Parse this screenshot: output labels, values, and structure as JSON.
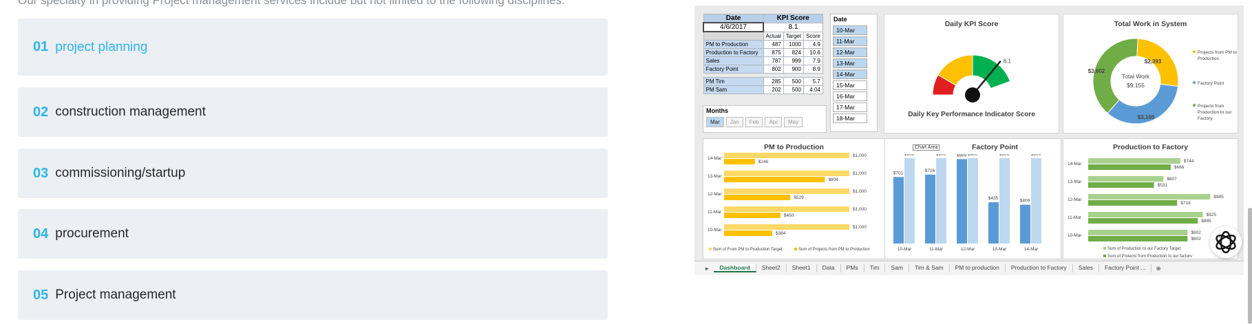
{
  "intro_text": "Our specialty in providing Project management services include but not limited to the following disciplines:",
  "accordion": [
    {
      "num": "01",
      "label": "project planning",
      "active": true
    },
    {
      "num": "02",
      "label": "construction management"
    },
    {
      "num": "03",
      "label": "commissioning/startup"
    },
    {
      "num": "04",
      "label": "procurement"
    },
    {
      "num": "05",
      "label": "Project management"
    }
  ],
  "dashboard": {
    "kpi_table": {
      "date_header": "Date",
      "kpi_header": "KPI Score",
      "date_value": "4/6/2017",
      "kpi_value": "8.1",
      "cols": [
        "Actual",
        "Target",
        "Score"
      ],
      "rows": [
        {
          "name": "PM to Production",
          "actual": "487",
          "target": "1000",
          "score": "4.9"
        },
        {
          "name": "Production to Factory",
          "actual": "875",
          "target": "824",
          "score": "10.6"
        },
        {
          "name": "Sales",
          "actual": "787",
          "target": "999",
          "score": "7.9"
        },
        {
          "name": "Factory Point",
          "actual": "802",
          "target": "900",
          "score": "8.9"
        }
      ],
      "pm_rows": [
        {
          "name": "PM Tim",
          "actual": "285",
          "target": "500",
          "score": "5.7"
        },
        {
          "name": "PM Sam",
          "actual": "202",
          "target": "500",
          "score": "4.04"
        }
      ]
    },
    "date_slicer": {
      "title": "Date",
      "items": [
        "10-Mar",
        "11-Mar",
        "12-Mar",
        "13-Mar",
        "14-Mar",
        "15-Mar",
        "16-Mar",
        "17-Mar",
        "18-Mar"
      ],
      "selected_count": 5
    },
    "months_slicer": {
      "title": "Months",
      "items": [
        "Mar",
        "Jan",
        "Feb",
        "Apr",
        "May"
      ]
    },
    "sheet_tabs": [
      "Dashboard",
      "Sheet2",
      "Sheet1",
      "Data",
      "PMs",
      "Tim",
      "Sam",
      "Tim & Sam",
      "PM to production",
      "Production to Factory",
      "Sales",
      "Factory Point ..."
    ],
    "tooltip": "Chart Area"
  },
  "chart_data": [
    {
      "type": "gauge",
      "title": "Daily KPI Score",
      "subtitle": "Daily Key Performance Indicator Score",
      "value": 8.1,
      "value_label": "8.1",
      "bands": [
        {
          "color": "#e02020"
        },
        {
          "color": "#ffc000"
        },
        {
          "color": "#00b050"
        }
      ]
    },
    {
      "type": "pie",
      "title": "Total Work in System",
      "center_label": "Total Work",
      "center_value": "$9,155",
      "slices": [
        {
          "label": "$2,393",
          "value": 2393,
          "color": "#ffc000"
        },
        {
          "label": "$3,160",
          "value": 3160,
          "color": "#5b9bd5"
        },
        {
          "label": "$3,602",
          "value": 3602,
          "color": "#70ad47"
        }
      ],
      "legend": [
        "Projects from PM to Production",
        "Factory Point",
        "Projects from Production to our Factory"
      ]
    },
    {
      "type": "bar",
      "title": "PM to Production",
      "categories": [
        "14-Mar",
        "13-Mar",
        "12-Mar",
        "11-Mar",
        "10-Mar"
      ],
      "series": [
        {
          "name": "Sum of From PM to Production Target",
          "values": [
            1000,
            1000,
            1000,
            1000,
            1000
          ],
          "labels": [
            "$1,000",
            "$1,000",
            "$1,000",
            "$1,000",
            "$1,000"
          ],
          "color": "#ffd966"
        },
        {
          "name": "Sum of Projects from PM to Production",
          "values": [
            246,
            804,
            529,
            450,
            384
          ],
          "labels": [
            "$246",
            "$804",
            "$529",
            "$450",
            "$384"
          ],
          "color": "#ffc000"
        }
      ]
    },
    {
      "type": "bar",
      "title": "Factory Point",
      "categories": [
        "10-Mar",
        "11-Mar",
        "12-Mar",
        "13-Mar",
        "14-Mar"
      ],
      "series": [
        {
          "values": [
            701,
            726,
            889,
            435,
            409
          ],
          "labels": [
            "$701",
            "$726",
            "$889",
            "$435",
            "$409"
          ],
          "color": "#5b9bd5"
        },
        {
          "values": [
            900,
            900,
            900,
            900,
            900
          ],
          "labels": [
            "$900",
            "$900",
            "$900",
            "$900",
            "$900"
          ],
          "color": "#bdd7ee"
        }
      ]
    },
    {
      "type": "bar",
      "title": "Production to Factory",
      "categories": [
        "14-Mar",
        "13-Mar",
        "12-Mar",
        "11-Mar",
        "10-Mar"
      ],
      "series": [
        {
          "name": "Sum of Production to our Factory Target",
          "values": [
            744,
            607,
            985,
            925,
            802
          ],
          "labels": [
            "$744",
            "$607",
            "$985",
            "$925",
            "$802"
          ],
          "color": "#a9d18e"
        },
        {
          "name": "Sum of Projects from Production to our factory",
          "values": [
            666,
            531,
            718,
            885,
            802
          ],
          "labels": [
            "$666",
            "$531",
            "$718",
            "$885",
            "$802"
          ],
          "color": "#70ad47"
        }
      ]
    }
  ]
}
